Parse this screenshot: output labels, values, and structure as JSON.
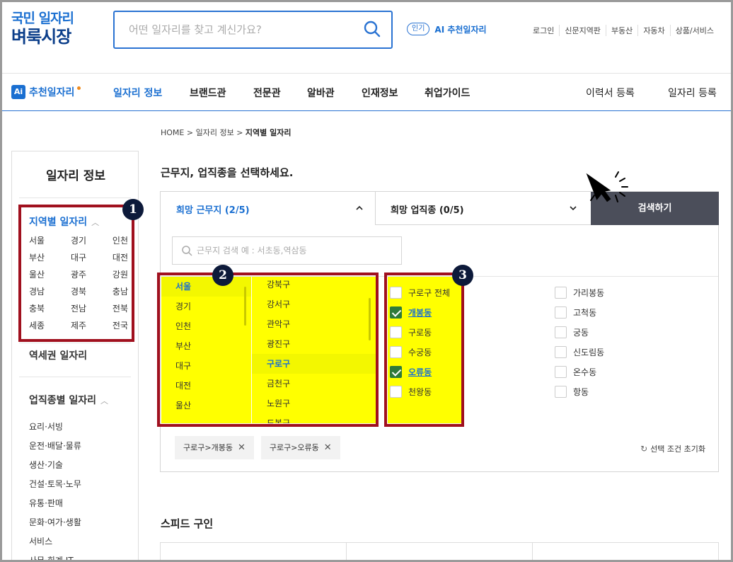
{
  "header": {
    "logo_line1": "국민 일자리",
    "logo_line2": "벼룩시장",
    "search_placeholder": "어떤 일자리를 찾고 계신가요?",
    "ai_pill": "인기",
    "ai_link": "AI 추천일자리",
    "util_links": [
      "로그인",
      "신문지역판",
      "부동산",
      "자동차",
      "상품/서비스"
    ]
  },
  "gnb": {
    "ai_badge": "Ai",
    "ai_label": "추천일자리",
    "menus": [
      "일자리 정보",
      "브랜드관",
      "전문관",
      "알바관",
      "인재정보",
      "취업가이드"
    ],
    "right_menus": [
      "이력서 등록",
      "일자리 등록"
    ]
  },
  "sidebar": {
    "title": "일자리 정보",
    "region_title": "지역별 일자리",
    "regions": [
      "서울",
      "경기",
      "인천",
      "부산",
      "대구",
      "대전",
      "울산",
      "광주",
      "강원",
      "경남",
      "경북",
      "충남",
      "충북",
      "전남",
      "전북",
      "세종",
      "제주",
      "전국"
    ],
    "station": "역세권 일자리",
    "job_title": "업직종별 일자리",
    "jobs": [
      "요리·서빙",
      "운전·배달·물류",
      "생산·기술",
      "건설·토목·노무",
      "유통·판매",
      "문화·여가·생활",
      "서비스",
      "사무·회계·IT"
    ]
  },
  "main": {
    "breadcrumb": [
      "HOME",
      "일자리 정보",
      "지역별 일자리"
    ],
    "guide": "근무지, 업직종을 선택하세요.",
    "tab_location": "희망 근무지 (2/5)",
    "tab_job": "희망 업직종 (0/5)",
    "search_button": "검색하기",
    "loc_placeholder": "근무지 검색 예 : 서초동,역삼동",
    "cities": [
      "서울",
      "경기",
      "인천",
      "부산",
      "대구",
      "대전",
      "울산"
    ],
    "selected_city": "서울",
    "districts": [
      "강북구",
      "강서구",
      "관악구",
      "광진구",
      "구로구",
      "금천구",
      "노원구",
      "도봉구"
    ],
    "selected_district": "구로구",
    "dongs_left": [
      {
        "label": "구로구 전체",
        "checked": false
      },
      {
        "label": "개봉동",
        "checked": true
      },
      {
        "label": "구로동",
        "checked": false
      },
      {
        "label": "수궁동",
        "checked": false
      },
      {
        "label": "오류동",
        "checked": true
      },
      {
        "label": "천왕동",
        "checked": false
      }
    ],
    "dongs_right": [
      {
        "label": "가리봉동",
        "checked": false
      },
      {
        "label": "고척동",
        "checked": false
      },
      {
        "label": "궁동",
        "checked": false
      },
      {
        "label": "신도림동",
        "checked": false
      },
      {
        "label": "온수동",
        "checked": false
      },
      {
        "label": "항동",
        "checked": false
      }
    ],
    "tags": [
      "구로구>개봉동",
      "구로구>오류동"
    ],
    "reset": "선택 조건 초기화",
    "speed_title": "스피드 구인"
  },
  "annotations": {
    "badge1": "1",
    "badge2": "2",
    "badge3": "3"
  },
  "colors": {
    "accent": "#1a6fd1",
    "highlight": "#ffff00",
    "annotation_border": "#a0101e",
    "search_button": "#4b4e5a",
    "checked": "#2f7a3a"
  }
}
